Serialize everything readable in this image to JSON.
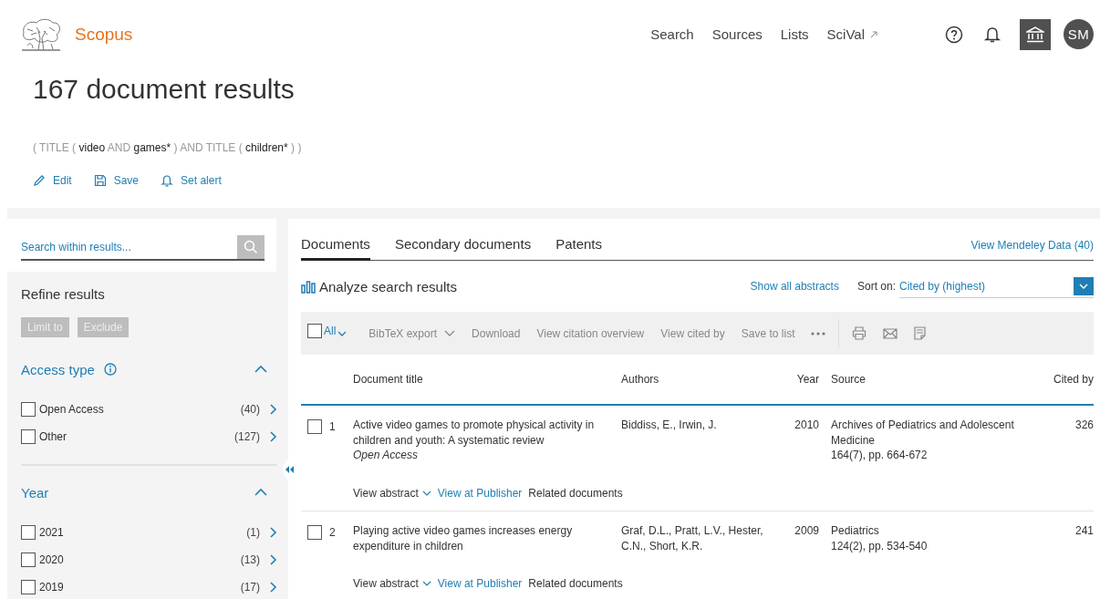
{
  "header": {
    "logo_text": "Scopus",
    "nav": [
      {
        "label": "Search",
        "external": false
      },
      {
        "label": "Sources",
        "external": false
      },
      {
        "label": "Lists",
        "external": false
      },
      {
        "label": "SciVal",
        "external": true
      }
    ],
    "user_initials": "SM"
  },
  "title": "167 document results",
  "query": [
    {
      "text": "( TITLE (",
      "kind": "operator"
    },
    {
      "text": "video",
      "kind": "term"
    },
    {
      "text": "AND",
      "kind": "operator"
    },
    {
      "text": "games*",
      "kind": "term"
    },
    {
      "text": ") AND TITLE (",
      "kind": "operator"
    },
    {
      "text": "children*",
      "kind": "term"
    },
    {
      "text": ") )",
      "kind": "operator"
    }
  ],
  "actions": [
    {
      "label": "Edit",
      "kind": "edit"
    },
    {
      "label": "Save",
      "kind": "save"
    },
    {
      "label": "Set alert",
      "kind": "alert"
    }
  ],
  "sidebar": {
    "search_placeholder": "Search within results...",
    "refine_title": "Refine results",
    "buttons": [
      {
        "label": "Limit to",
        "disabled": true
      },
      {
        "label": "Exclude",
        "disabled": true
      }
    ],
    "facets": [
      {
        "title": "Access type",
        "info": true,
        "expanded": true,
        "options": [
          {
            "label": "Open Access",
            "count": "(40)",
            "checked": false
          },
          {
            "label": "Other",
            "count": "(127)",
            "checked": false
          }
        ]
      },
      {
        "title": "Year",
        "info": false,
        "expanded": true,
        "options": [
          {
            "label": "2021",
            "count": "(1)",
            "checked": false
          },
          {
            "label": "2020",
            "count": "(13)",
            "checked": false
          },
          {
            "label": "2019",
            "count": "(17)",
            "checked": false
          }
        ]
      }
    ]
  },
  "results": {
    "tabs": [
      {
        "label": "Documents",
        "selected": true
      },
      {
        "label": "Secondary documents",
        "selected": false
      },
      {
        "label": "Patents",
        "selected": false
      }
    ],
    "mendeley_link": "View Mendeley Data (40)",
    "analyze_label": "Analyze search results",
    "show_abstracts": "Show all abstracts",
    "sort_label": "Sort on:",
    "sort_value": "Cited by (highest)",
    "toolbar": {
      "all_label": "All",
      "all_checked": false,
      "actions": [
        {
          "label": "BibTeX export",
          "dropdown": true
        },
        {
          "label": "Download",
          "dropdown": false
        },
        {
          "label": "View citation overview",
          "dropdown": false
        },
        {
          "label": "View cited by",
          "dropdown": false
        },
        {
          "label": "Save to list",
          "dropdown": false
        }
      ]
    },
    "columns": [
      "Document title",
      "Authors",
      "Year",
      "Source",
      "Cited by"
    ],
    "rows": [
      {
        "number": "1",
        "checked": false,
        "title": "Active video games to promote physical activity in children and youth: A systematic review",
        "access": "Open Access",
        "authors": "Biddiss, E., Irwin, J.",
        "year": "2010",
        "source": "Archives of Pediatrics and Adolescent Medicine",
        "source_detail": "164(7), pp. 664-672",
        "cited_by": "326",
        "links": [
          {
            "label": "View abstract",
            "kind": "expand"
          },
          {
            "label": "View at Publisher",
            "kind": "link"
          },
          {
            "label": "Related documents",
            "kind": "plain"
          }
        ]
      },
      {
        "number": "2",
        "checked": false,
        "title": "Playing active video games increases energy expenditure in children",
        "authors": "Graf, D.L., Pratt, L.V., Hester, C.N., Short, K.R.",
        "year": "2009",
        "source": "Pediatrics",
        "source_detail": "124(2), pp. 534-540",
        "cited_by": "241",
        "links": [
          {
            "label": "View abstract",
            "kind": "expand"
          },
          {
            "label": "View at Publisher",
            "kind": "link"
          },
          {
            "label": "Related documents",
            "kind": "plain"
          }
        ]
      }
    ]
  }
}
